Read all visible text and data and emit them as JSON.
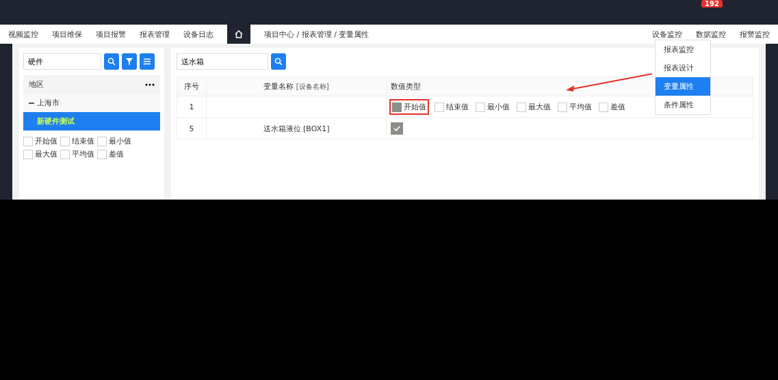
{
  "header": {
    "badge": "192"
  },
  "nav": {
    "left": [
      {
        "label": "视频监控"
      },
      {
        "label": "项目维保"
      },
      {
        "label": "项目报警"
      },
      {
        "label": "报表管理"
      },
      {
        "label": "设备日志"
      }
    ],
    "breadcrumb": "项目中心 / 报表管理 / 变量属性",
    "right": [
      {
        "label": "设备监控"
      },
      {
        "label": "数据监控"
      },
      {
        "label": "报警监控"
      }
    ]
  },
  "menu": [
    {
      "label": "报表监控",
      "selected": false
    },
    {
      "label": "报表设计",
      "selected": false
    },
    {
      "label": "变量属性",
      "selected": true
    },
    {
      "label": "条件属性",
      "selected": false
    }
  ],
  "tree": {
    "search": "硬件",
    "section": "地区",
    "items": [
      {
        "label": "上海市",
        "expanded": true,
        "children": [
          {
            "label": "新硬件测试",
            "selected": true
          }
        ]
      }
    ]
  },
  "table": {
    "search": "送水箱",
    "columns": [
      "序号",
      "变量名称",
      "[设备名称]",
      "数值类型"
    ],
    "rows": [
      {
        "index": "1",
        "name": "",
        "options": [
          {
            "label": "开始值",
            "checked": true
          },
          {
            "label": "结束值",
            "checked": false
          },
          {
            "label": "最小值",
            "checked": false
          },
          {
            "label": "最大值",
            "checked": false
          },
          {
            "label": "平均值",
            "checked": false
          },
          {
            "label": "差值",
            "checked": false
          }
        ]
      },
      {
        "index": "5",
        "name": "送水箱液位",
        "device": "[BOX1]",
        "checked": true
      }
    ]
  },
  "value_rows": [
    [
      {
        "label": "开始值",
        "checked": false
      },
      {
        "label": "结束值",
        "checked": false
      },
      {
        "label": "最小值",
        "checked": false
      },
      {
        "label": "最大值",
        "checked": false
      },
      {
        "label": "平均值",
        "checked": false
      },
      {
        "label": "差值",
        "checked": false
      }
    ]
  ]
}
